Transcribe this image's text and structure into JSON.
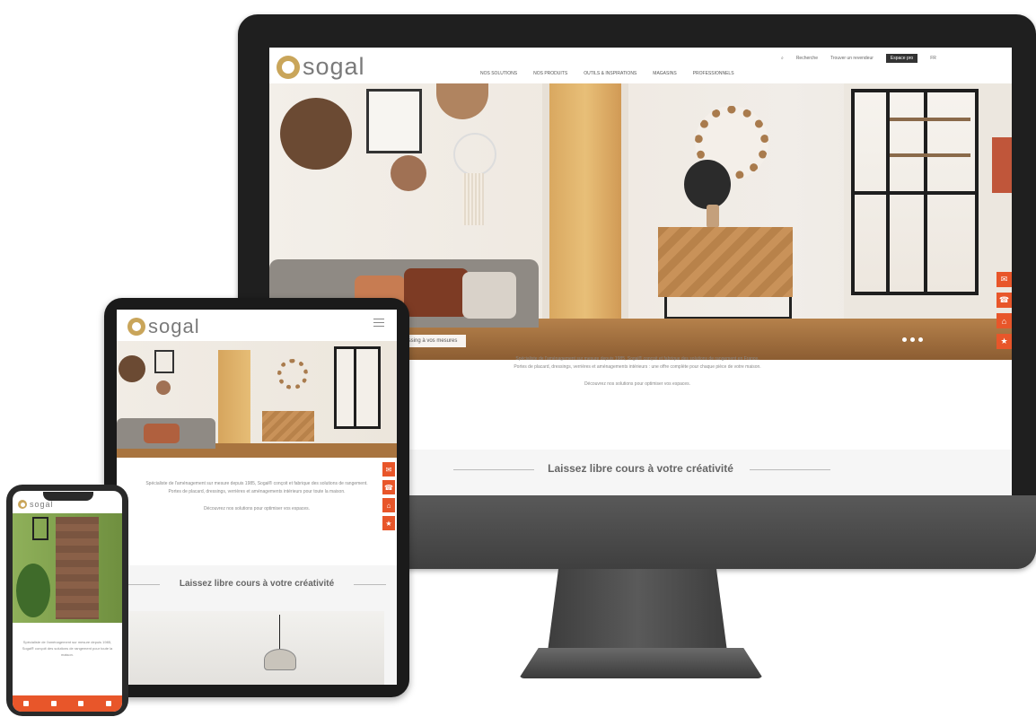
{
  "brand": {
    "name": "sogal",
    "accent_color": "#e8562a",
    "logo_color": "#c9a55a"
  },
  "desktop": {
    "nav": {
      "menu_items": [
        "Nos solutions",
        "Nos produits",
        "Outils & inspirations",
        "Magasins",
        "Professionnels"
      ],
      "top_links": [
        "Recherche",
        "Trouver un revendeur"
      ],
      "pro_button": "Espace pro",
      "lang": "FR"
    },
    "hero": {
      "caption": "Dressing à vos mesures"
    },
    "side_buttons": [
      "✉",
      "☎",
      "⌂",
      "★"
    ],
    "intro_line1": "Spécialiste de l'aménagement sur mesure depuis 1985, Sogal® conçoit et fabrique des solutions de rangement en France.",
    "intro_line2": "Portes de placard, dressings, verrières et aménagements intérieurs : une offre complète pour chaque pièce de votre maison.",
    "intro_line3": "Découvrez nos solutions pour optimiser vos espaces.",
    "section_heading": "Laissez libre cours à votre créativité"
  },
  "tablet": {
    "intro_line1": "Spécialiste de l'aménagement sur mesure depuis 1985, Sogal® conçoit et fabrique des solutions de rangement.",
    "intro_line2": "Portes de placard, dressings, verrières et aménagements intérieurs pour toute la maison.",
    "intro_line3": "Découvrez nos solutions pour optimiser vos espaces.",
    "side_buttons": [
      "✉",
      "☎",
      "⌂",
      "★"
    ],
    "section_heading": "Laissez libre cours à votre créativité"
  },
  "phone": {
    "intro": "Spécialiste de l'aménagement sur mesure depuis 1985, Sogal® conçoit des solutions de rangement pour toute la maison."
  }
}
